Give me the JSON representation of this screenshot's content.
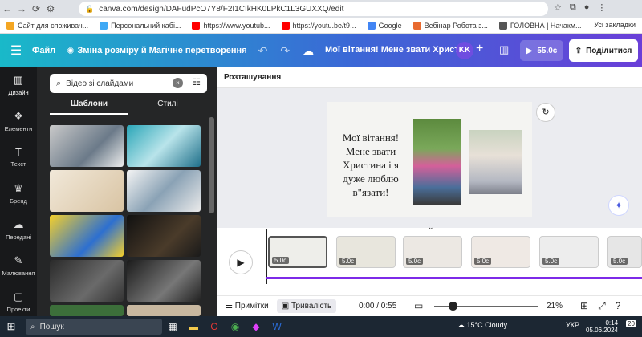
{
  "browser": {
    "url": "canva.com/design/DAFudPcO7Y8/F2I1CIkHK0LPkC1L3GUXXQ/edit",
    "bookmarks": [
      {
        "label": "Сайт для споживач...",
        "color": "#f4a623"
      },
      {
        "label": "Персональний кабі...",
        "color": "#3fa9f5"
      },
      {
        "label": "https://www.youtub...",
        "color": "#ff0000"
      },
      {
        "label": "https://youtu.be/t9...",
        "color": "#ff0000"
      },
      {
        "label": "Google",
        "color": "#4285f4"
      },
      {
        "label": "Вебінар Робота з...",
        "color": "#e86a2f"
      },
      {
        "label": "ГОЛОВНА | Начакм...",
        "color": "#555555"
      }
    ],
    "all_bookmarks": "Усі закладки"
  },
  "header": {
    "file": "Файл",
    "resize": "Зміна розміру й Магічне перетворення",
    "doc_title": "Мої вітання! Мене звати Христ...",
    "avatar": "KK",
    "play_duration": "55.0с",
    "share": "Поділитися"
  },
  "rail": [
    {
      "icon": "design-icon",
      "label": "Дизайн"
    },
    {
      "icon": "elements-icon",
      "label": "Елементи"
    },
    {
      "icon": "text-icon",
      "label": "Текст"
    },
    {
      "icon": "brand-icon",
      "label": "Бренд"
    },
    {
      "icon": "uploads-icon",
      "label": "Передані"
    },
    {
      "icon": "draw-icon",
      "label": "Малювання"
    },
    {
      "icon": "projects-icon",
      "label": "Проекти"
    }
  ],
  "panel": {
    "search_value": "Відео зі слайдами",
    "tab_templates": "Шаблони",
    "tab_styles": "Стилі"
  },
  "canvas": {
    "position_label": "Розташування",
    "slide_text": "Мої вітання!\nМене звати\nХристина і я\nдуже люблю\nв\"язати!"
  },
  "timeline": {
    "clips": [
      "5.0с",
      "5.0с",
      "5.0с",
      "5.0с",
      "5.0с",
      "5.0с"
    ]
  },
  "bottom": {
    "notes": "Примітки",
    "duration": "Тривалість",
    "time": "0:00 / 0:55",
    "zoom": "21%"
  },
  "taskbar": {
    "search": "Пошук",
    "weather": "15°C Cloudy",
    "lang": "УКР",
    "clock": "0:14",
    "date": "05.06.2024",
    "badge": "20"
  }
}
